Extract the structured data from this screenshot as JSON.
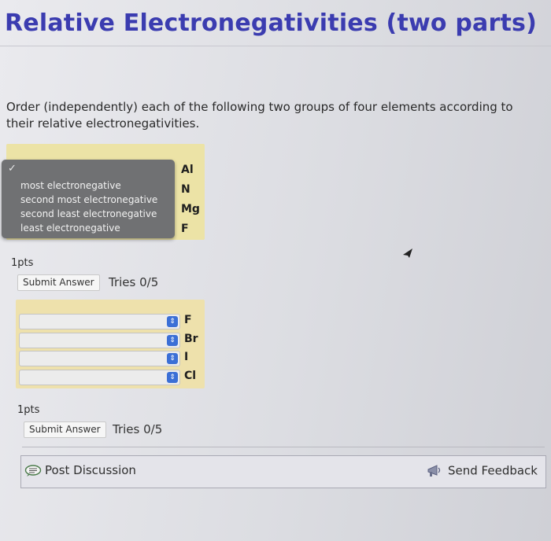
{
  "page": {
    "title": "Relative Electronegativities (two parts)",
    "instructions": "Order (independently) each of the following two groups of four elements according to their relative electronegativities."
  },
  "part1": {
    "menu_options": [
      "most electronegative",
      "second most electronegative",
      "second least electronegative",
      "least electronegative"
    ],
    "elements": [
      "Al",
      "N",
      "Mg",
      "F"
    ],
    "points": "1pts",
    "submit_label": "Submit Answer",
    "tries": "Tries 0/5"
  },
  "part2": {
    "elements": [
      "F",
      "Br",
      "I",
      "Cl"
    ],
    "select_values": [
      "",
      "",
      "",
      ""
    ],
    "points": "1pts",
    "submit_label": "Submit Answer",
    "tries": "Tries 0/5"
  },
  "footer": {
    "post_discussion": "Post Discussion",
    "send_feedback": "Send Feedback"
  },
  "colors": {
    "title": "#3b3cb0",
    "highlight": "#ece3a6",
    "menu_bg": "#707173",
    "select_arrow": "#3b6fd6"
  }
}
